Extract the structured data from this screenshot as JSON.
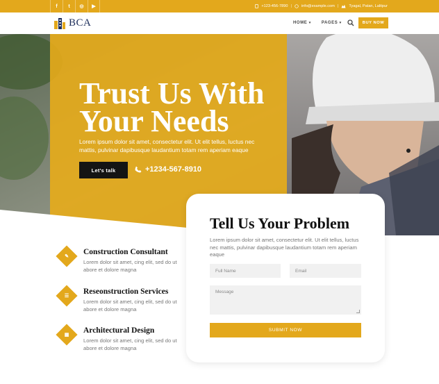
{
  "topbar": {
    "social": [
      {
        "icon": "facebook-icon",
        "glyph": "f"
      },
      {
        "icon": "twitter-icon",
        "glyph": "t"
      },
      {
        "icon": "instagram-icon",
        "glyph": "◎"
      },
      {
        "icon": "youtube-icon",
        "glyph": "▶"
      }
    ],
    "phone": "+123-456-7890",
    "email": "info@example.com",
    "address": "Tyagal, Patan, Lalitpur"
  },
  "nav": {
    "logo_text": "BCA",
    "items": [
      {
        "label": "HOME"
      },
      {
        "label": "PAGES"
      }
    ],
    "buy_label": "BUY NOW"
  },
  "hero": {
    "title_line1": "Trust Us With",
    "title_line2": "Your Needs",
    "text": "Lorem ipsum dolor sit amet, consectetur elit. Ut elit tellus, luctus nec mattis, pulvinar dapibusque laudantium totam rem aperiam eaque",
    "cta_label": "Let's talk",
    "phone": "+1234-567-8910"
  },
  "services": [
    {
      "title": "Construction Consultant",
      "text": "Lorem dolor sit amet, cing elit, sed do ut abore et dolore magna",
      "icon": "handshake-icon",
      "glyph": "✎"
    },
    {
      "title": "Reseonstruction Services",
      "text": "Lorem dolor sit amet, cing elit, sed do ut abore et dolore magna",
      "icon": "list-icon",
      "glyph": "☰"
    },
    {
      "title": "Architectural Design",
      "text": "Lorem dolor sit amet, cing elit, sed do ut abore et dolore magna",
      "icon": "building-icon",
      "glyph": "▦"
    }
  ],
  "form": {
    "title": "Tell Us Your Problem",
    "text": "Lorem ipsum dolor sit amet, consectetur elit. Ut elit tellus, luctus nec mattis, pulvinar dapibusque laudantium totam rem aperiam eaque",
    "name_placeholder": "Full Name",
    "email_placeholder": "Email",
    "message_placeholder": "Message",
    "submit_label": "SUBMIT NOW"
  },
  "colors": {
    "accent": "#e3a81c",
    "dark": "#141414",
    "text_muted": "#777777"
  }
}
